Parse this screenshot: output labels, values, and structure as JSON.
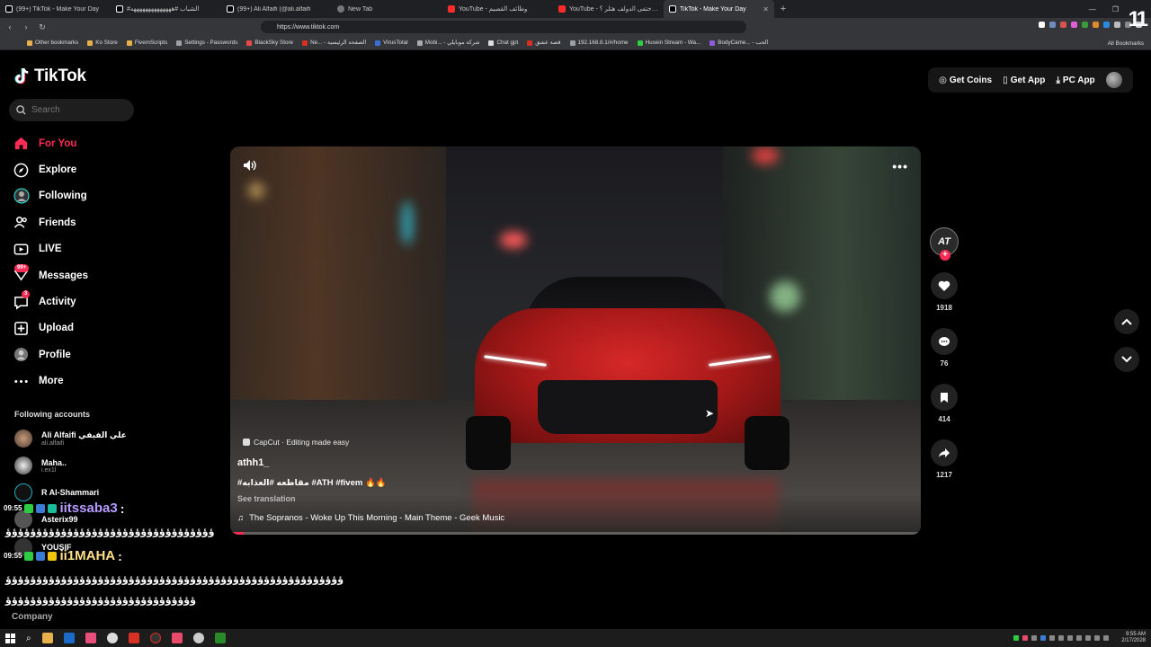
{
  "browser": {
    "tabs": [
      {
        "title": "(99+) TikTok - Make Your Day",
        "fav": "tk"
      },
      {
        "title": "#الشباب #ههههههههههههههه",
        "fav": "tk"
      },
      {
        "title": "(99+) Ali Alfaifi (@ali.alfaifi",
        "fav": "tk"
      },
      {
        "title": "New Tab",
        "fav": "gray"
      },
      {
        "title": "YouTube - وظائف القصيم",
        "fav": "red"
      },
      {
        "title": "YouTube - اين اختفى الدولف هتلر ؟",
        "fav": "red"
      },
      {
        "title": "TikTok - Make Your Day",
        "fav": "tk",
        "active": true
      }
    ],
    "url": "https://www.tiktok.com",
    "bookmarks": [
      {
        "label": "Other bookmarks",
        "color": "#e8b04a"
      },
      {
        "label": "Ko Store",
        "color": "#e8b04a"
      },
      {
        "label": "FivemScripts",
        "color": "#e8b04a"
      },
      {
        "label": "Settings - Passwords",
        "color": "#9aa0a6"
      },
      {
        "label": "BlackSky Store",
        "color": "#e84a4a"
      },
      {
        "label": "Ne... - الصفحة الرئيسية",
        "color": "#d93025"
      },
      {
        "label": "VirusTotal",
        "color": "#3b6fd8"
      },
      {
        "label": "Mobi... - شركة موبايلي",
        "color": "#aaa"
      },
      {
        "label": "Chat gpt",
        "color": "#ddd"
      },
      {
        "label": "قصة عشق",
        "color": "#d93025"
      },
      {
        "label": "192.168.8.1/#/home",
        "color": "#9aa0a6"
      },
      {
        "label": "Husein Stream - Wa...",
        "color": "#2ecc40"
      },
      {
        "label": "BodyCame... - الحب",
        "color": "#8e5cd8"
      }
    ],
    "all_bookmarks": "All Bookmarks"
  },
  "tiktok": {
    "brand": "TikTok",
    "search_placeholder": "Search",
    "nav": [
      {
        "key": "for-you",
        "label": "For You",
        "icon": "home-icon",
        "active": true
      },
      {
        "key": "explore",
        "label": "Explore",
        "icon": "compass-icon"
      },
      {
        "key": "following",
        "label": "Following",
        "icon": "following-icon"
      },
      {
        "key": "friends",
        "label": "Friends",
        "icon": "friends-icon"
      },
      {
        "key": "live",
        "label": "LIVE",
        "icon": "live-icon"
      },
      {
        "key": "messages",
        "label": "Messages",
        "icon": "messages-icon",
        "badge": "99+"
      },
      {
        "key": "activity",
        "label": "Activity",
        "icon": "activity-icon",
        "badge": "3"
      },
      {
        "key": "upload",
        "label": "Upload",
        "icon": "upload-icon"
      },
      {
        "key": "profile",
        "label": "Profile",
        "icon": "profile-icon"
      },
      {
        "key": "more",
        "label": "More",
        "icon": "more-icon"
      }
    ],
    "following_title": "Following accounts",
    "accounts": [
      {
        "name": "Ali Alfaifi علي الفيفي",
        "handle": "ali.alfaifi"
      },
      {
        "name": "Maha..",
        "handle": "i.ex1l"
      },
      {
        "name": "R Al-Shammari",
        "handle": ""
      },
      {
        "name": "Asterix99",
        "handle": ""
      },
      {
        "name": "YOUSIF",
        "handle": ""
      }
    ],
    "company": "Company",
    "top": {
      "coins": "Get Coins",
      "app": "Get App",
      "pc": "PC App"
    },
    "video": {
      "capcut": "CapCut · Editing made easy",
      "author": "athh1_",
      "description": "#مقاطعه #العذابه #ATH #fivem 🔥🔥",
      "translation": "See translation",
      "music": "The Sopranos - Woke Up This Morning - Main Theme - Geek Music",
      "progress": 0.02
    },
    "actions": {
      "creator_initials": "AT",
      "likes": "1918",
      "comments": "76",
      "saves": "414",
      "shares": "1217"
    }
  },
  "chat": [
    {
      "time": "09:55",
      "user": "iitssaba3",
      "colon": ":",
      "msg": "ؤؤؤؤؤؤؤؤؤؤؤؤؤؤؤؤؤؤؤؤؤؤؤؤؤؤؤؤؤؤؤؤؤؤ",
      "color": "#b79bff"
    },
    {
      "time": "09:55",
      "user": "ii1MAHA",
      "colon": ":",
      "msg": "ؤؤؤؤؤؤؤؤؤؤؤؤؤؤؤؤؤؤؤؤؤؤؤؤؤؤؤؤؤؤؤؤؤؤؤؤؤؤؤؤؤؤؤؤؤؤؤؤؤؤؤؤؤؤؤ",
      "msg2": "ؤؤؤؤؤؤؤؤؤؤؤؤؤؤؤؤؤؤؤؤؤؤؤؤؤؤؤؤؤؤؤ",
      "color": "#ffe08a"
    }
  ],
  "taskbar": {
    "time": "9:55 AM",
    "date": "2/17/2028"
  },
  "overlay_logo": "11"
}
